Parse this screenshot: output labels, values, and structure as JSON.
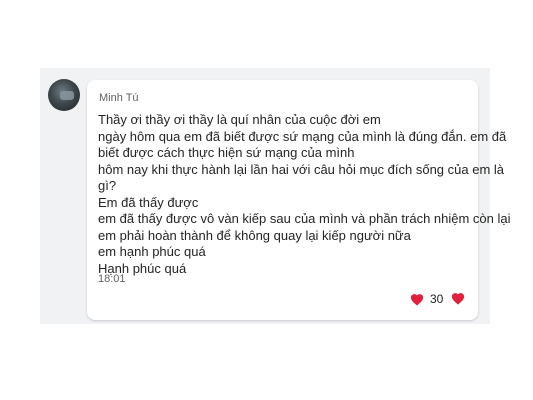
{
  "message": {
    "sender": "Minh Tú",
    "lines": [
      "Thầy ơi thầy ơi thầy là quí nhân của cuộc đời em",
      "ngày hôm qua em đã biết được sứ mạng của mình là đúng đắn. em đã",
      "biết được cách thực hiện sứ mạng của mình",
      "hôm nay khi thực hành lại lần hai với câu hỏi mục đích sống của em là",
      "gì?",
      "Em đã thấy được",
      "em đã thấy được vô vàn kiếp sau của mình và phần trách nhiệm còn lại",
      "em phải hoàn thành để không quay lại kiếp người nữa",
      "em hạnh phúc quá",
      "Hạnh phúc quá"
    ],
    "time": "18:01"
  },
  "reactions": {
    "icon": "heart-icon",
    "count": "30",
    "color": "#e0203d"
  }
}
